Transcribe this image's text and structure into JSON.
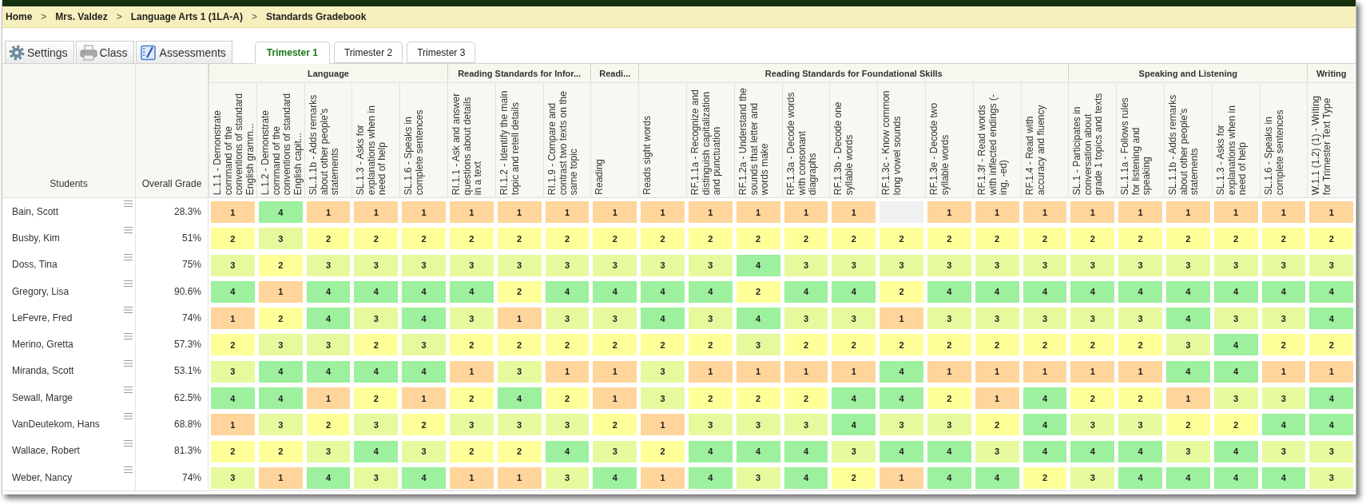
{
  "breadcrumb": [
    {
      "kind": "link",
      "text": "Home"
    },
    {
      "kind": "separator",
      "text": ">"
    },
    {
      "kind": "link",
      "text": "Mrs. Valdez"
    },
    {
      "kind": "separator",
      "text": ">"
    },
    {
      "kind": "link",
      "text": "Language Arts 1 (1LA-A)"
    },
    {
      "kind": "separator",
      "text": ">"
    },
    {
      "kind": "current",
      "text": "Standards Gradebook"
    }
  ],
  "toolbar": [
    {
      "label": "Settings"
    },
    {
      "label": "Class"
    },
    {
      "label": "Assessments"
    }
  ],
  "trimester_tabs": [
    {
      "label": "Trimester 1",
      "selected": true
    },
    {
      "label": "Trimester 2",
      "selected": false
    },
    {
      "label": "Trimester 3",
      "selected": false
    }
  ],
  "table": {
    "student_column": "Students",
    "grade_column": "Overall Grade",
    "groups": [
      {
        "title": "Language",
        "standards": [
          "L.1.1 - Demonstrate command of the conventions of standard English gramm...",
          "L.1.2 - Demonstrate command of the conventions of standard English capit...",
          "SL.1.1b - Adds remarks about other people's statements",
          "SL.1.3 - Asks for explanations when in need of help",
          "SL.1.6 - Speaks in complete sentences"
        ]
      },
      {
        "title": "Reading Standards for Infor...",
        "standards": [
          "RI.1.1 - Ask and answer questions about details in a text",
          "RI.1.2 - Identify the main topic and retell details",
          "RI.1.9 - Compare and contrast two texts on the same topic"
        ]
      },
      {
        "title": "Readi...",
        "standards": [
          "Reading"
        ]
      },
      {
        "title": "Reading Standards for Foundational Skills",
        "standards": [
          "Reads sight words",
          "RF.1.1a - Recognize and distinguish capitalization and punctuation",
          "RF.1.2a - Understand the sounds that letter and words make",
          "RF.1.3a - Decode words with consonant diagraphs",
          "RF.1.3b - Decode one syllable words",
          "RF.1.3c - Know common long vowel sounds",
          "RF.1.3e - Decode two syllable words",
          "RF.1.3f - Read words with inflected endings (-ing, -ed)",
          "RF.1.4 - Read with accuracy and fluency"
        ]
      },
      {
        "title": "Speaking and Listening",
        "standards": [
          "SL.1 - Participates in conversation about grade 1 topics and texts",
          "SL.1.1a - Follows rules for listening and speaking",
          "SL.1.1b - Adds remarks about other people's statements",
          "SL.1.3 - Asks for explanations when in need of help",
          "SL.1.6 - Speaks in complete sentences"
        ]
      },
      {
        "title": "Writing",
        "standards": [
          "W.1.1 (1.2) (1) - Writing for Trimester Text Type"
        ]
      }
    ],
    "rows": [
      {
        "student": "Bain, Scott",
        "grade": "28.3%",
        "scores": [
          {
            "score": "1",
            "color": "#ffd59b"
          },
          {
            "score": "4",
            "color": "#9df09d"
          },
          {
            "score": "1",
            "color": "#ffd59b"
          },
          {
            "score": "1",
            "color": "#ffd59b"
          },
          {
            "score": "1",
            "color": "#ffd59b"
          },
          {
            "score": "1",
            "color": "#ffd59b"
          },
          {
            "score": "1",
            "color": "#ffd59b"
          },
          {
            "score": "1",
            "color": "#ffd59b"
          },
          {
            "score": "1",
            "color": "#ffd59b"
          },
          {
            "score": "1",
            "color": "#ffd59b"
          },
          {
            "score": "1",
            "color": "#ffd59b"
          },
          {
            "score": "1",
            "color": "#ffd59b"
          },
          {
            "score": "1",
            "color": "#ffd59b"
          },
          {
            "score": "1",
            "color": "#ffd59b"
          },
          {
            "color": "#f0f0f0"
          },
          {
            "score": "1",
            "color": "#ffd59b"
          },
          {
            "score": "1",
            "color": "#ffd59b"
          },
          {
            "score": "1",
            "color": "#ffd59b"
          },
          {
            "score": "1",
            "color": "#ffd59b"
          },
          {
            "score": "1",
            "color": "#ffd59b"
          },
          {
            "score": "1",
            "color": "#ffd59b"
          },
          {
            "score": "1",
            "color": "#ffd59b"
          },
          {
            "score": "1",
            "color": "#ffd59b"
          },
          {
            "score": "1",
            "color": "#ffd59b"
          }
        ]
      },
      {
        "student": "Busby, Kim",
        "grade": "51%",
        "scores": [
          {
            "score": "2",
            "color": "#ffff99"
          },
          {
            "score": "3",
            "color": "#e6fa9d"
          },
          {
            "score": "2",
            "color": "#ffff99"
          },
          {
            "score": "2",
            "color": "#ffff99"
          },
          {
            "score": "2",
            "color": "#ffff99"
          },
          {
            "score": "2",
            "color": "#ffff99"
          },
          {
            "score": "2",
            "color": "#ffff99"
          },
          {
            "score": "2",
            "color": "#ffff99"
          },
          {
            "score": "2",
            "color": "#ffff99"
          },
          {
            "score": "2",
            "color": "#ffff99"
          },
          {
            "score": "2",
            "color": "#ffff99"
          },
          {
            "score": "2",
            "color": "#ffff99"
          },
          {
            "score": "2",
            "color": "#ffff99"
          },
          {
            "score": "2",
            "color": "#ffff99"
          },
          {
            "score": "2",
            "color": "#ffff99"
          },
          {
            "score": "2",
            "color": "#ffff99"
          },
          {
            "score": "2",
            "color": "#ffff99"
          },
          {
            "score": "2",
            "color": "#ffff99"
          },
          {
            "score": "2",
            "color": "#ffff99"
          },
          {
            "score": "2",
            "color": "#ffff99"
          },
          {
            "score": "2",
            "color": "#ffff99"
          },
          {
            "score": "2",
            "color": "#ffff99"
          },
          {
            "score": "2",
            "color": "#ffff99"
          },
          {
            "score": "2",
            "color": "#ffff99"
          }
        ]
      },
      {
        "student": "Doss, Tina",
        "grade": "75%",
        "scores": [
          {
            "score": "3",
            "color": "#e6fa9d"
          },
          {
            "score": "2",
            "color": "#ffff99"
          },
          {
            "score": "3",
            "color": "#e6fa9d"
          },
          {
            "score": "3",
            "color": "#e6fa9d"
          },
          {
            "score": "3",
            "color": "#e6fa9d"
          },
          {
            "score": "3",
            "color": "#e6fa9d"
          },
          {
            "score": "3",
            "color": "#e6fa9d"
          },
          {
            "score": "3",
            "color": "#e6fa9d"
          },
          {
            "score": "3",
            "color": "#e6fa9d"
          },
          {
            "score": "3",
            "color": "#e6fa9d"
          },
          {
            "score": "3",
            "color": "#e6fa9d"
          },
          {
            "score": "4",
            "color": "#9df09d"
          },
          {
            "score": "3",
            "color": "#e6fa9d"
          },
          {
            "score": "3",
            "color": "#e6fa9d"
          },
          {
            "score": "3",
            "color": "#e6fa9d"
          },
          {
            "score": "3",
            "color": "#e6fa9d"
          },
          {
            "score": "3",
            "color": "#e6fa9d"
          },
          {
            "score": "3",
            "color": "#e6fa9d"
          },
          {
            "score": "3",
            "color": "#e6fa9d"
          },
          {
            "score": "3",
            "color": "#e6fa9d"
          },
          {
            "score": "3",
            "color": "#e6fa9d"
          },
          {
            "score": "3",
            "color": "#e6fa9d"
          },
          {
            "score": "3",
            "color": "#e6fa9d"
          },
          {
            "score": "3",
            "color": "#e6fa9d"
          }
        ]
      },
      {
        "student": "Gregory, Lisa",
        "grade": "90.6%",
        "scores": [
          {
            "score": "4",
            "color": "#9df09d"
          },
          {
            "score": "1",
            "color": "#ffd59b"
          },
          {
            "score": "4",
            "color": "#9df09d"
          },
          {
            "score": "4",
            "color": "#9df09d"
          },
          {
            "score": "4",
            "color": "#9df09d"
          },
          {
            "score": "4",
            "color": "#9df09d"
          },
          {
            "score": "2",
            "color": "#ffff99"
          },
          {
            "score": "4",
            "color": "#9df09d"
          },
          {
            "score": "4",
            "color": "#9df09d"
          },
          {
            "score": "4",
            "color": "#9df09d"
          },
          {
            "score": "4",
            "color": "#9df09d"
          },
          {
            "score": "2",
            "color": "#ffff99"
          },
          {
            "score": "4",
            "color": "#9df09d"
          },
          {
            "score": "4",
            "color": "#9df09d"
          },
          {
            "score": "2",
            "color": "#ffff99"
          },
          {
            "score": "4",
            "color": "#9df09d"
          },
          {
            "score": "4",
            "color": "#9df09d"
          },
          {
            "score": "4",
            "color": "#9df09d"
          },
          {
            "score": "4",
            "color": "#9df09d"
          },
          {
            "score": "4",
            "color": "#9df09d"
          },
          {
            "score": "4",
            "color": "#9df09d"
          },
          {
            "score": "4",
            "color": "#9df09d"
          },
          {
            "score": "4",
            "color": "#9df09d"
          },
          {
            "score": "4",
            "color": "#9df09d"
          }
        ]
      },
      {
        "student": "LeFevre, Fred",
        "grade": "74%",
        "scores": [
          {
            "score": "1",
            "color": "#ffd59b"
          },
          {
            "score": "2",
            "color": "#ffff99"
          },
          {
            "score": "4",
            "color": "#9df09d"
          },
          {
            "score": "3",
            "color": "#e6fa9d"
          },
          {
            "score": "4",
            "color": "#9df09d"
          },
          {
            "score": "3",
            "color": "#e6fa9d"
          },
          {
            "score": "1",
            "color": "#ffd59b"
          },
          {
            "score": "3",
            "color": "#e6fa9d"
          },
          {
            "score": "3",
            "color": "#e6fa9d"
          },
          {
            "score": "4",
            "color": "#9df09d"
          },
          {
            "score": "3",
            "color": "#e6fa9d"
          },
          {
            "score": "4",
            "color": "#9df09d"
          },
          {
            "score": "3",
            "color": "#e6fa9d"
          },
          {
            "score": "3",
            "color": "#e6fa9d"
          },
          {
            "score": "1",
            "color": "#ffd59b"
          },
          {
            "score": "3",
            "color": "#e6fa9d"
          },
          {
            "score": "3",
            "color": "#e6fa9d"
          },
          {
            "score": "3",
            "color": "#e6fa9d"
          },
          {
            "score": "3",
            "color": "#e6fa9d"
          },
          {
            "score": "3",
            "color": "#e6fa9d"
          },
          {
            "score": "4",
            "color": "#9df09d"
          },
          {
            "score": "3",
            "color": "#e6fa9d"
          },
          {
            "score": "3",
            "color": "#e6fa9d"
          },
          {
            "score": "4",
            "color": "#9df09d"
          }
        ]
      },
      {
        "student": "Merino, Gretta",
        "grade": "57.3%",
        "scores": [
          {
            "score": "2",
            "color": "#ffff99"
          },
          {
            "score": "3",
            "color": "#e6fa9d"
          },
          {
            "score": "3",
            "color": "#e6fa9d"
          },
          {
            "score": "2",
            "color": "#ffff99"
          },
          {
            "score": "3",
            "color": "#e6fa9d"
          },
          {
            "score": "2",
            "color": "#ffff99"
          },
          {
            "score": "2",
            "color": "#ffff99"
          },
          {
            "score": "2",
            "color": "#ffff99"
          },
          {
            "score": "2",
            "color": "#ffff99"
          },
          {
            "score": "2",
            "color": "#ffff99"
          },
          {
            "score": "2",
            "color": "#ffff99"
          },
          {
            "score": "3",
            "color": "#e6fa9d"
          },
          {
            "score": "2",
            "color": "#ffff99"
          },
          {
            "score": "2",
            "color": "#ffff99"
          },
          {
            "score": "2",
            "color": "#ffff99"
          },
          {
            "score": "2",
            "color": "#ffff99"
          },
          {
            "score": "2",
            "color": "#ffff99"
          },
          {
            "score": "2",
            "color": "#ffff99"
          },
          {
            "score": "2",
            "color": "#ffff99"
          },
          {
            "score": "2",
            "color": "#ffff99"
          },
          {
            "score": "3",
            "color": "#e6fa9d"
          },
          {
            "score": "4",
            "color": "#9df09d"
          },
          {
            "score": "2",
            "color": "#ffff99"
          },
          {
            "score": "2",
            "color": "#ffff99"
          }
        ]
      },
      {
        "student": "Miranda, Scott",
        "grade": "53.1%",
        "scores": [
          {
            "score": "3",
            "color": "#e6fa9d"
          },
          {
            "score": "4",
            "color": "#9df09d"
          },
          {
            "score": "4",
            "color": "#9df09d"
          },
          {
            "score": "4",
            "color": "#9df09d"
          },
          {
            "score": "4",
            "color": "#9df09d"
          },
          {
            "score": "1",
            "color": "#ffd59b"
          },
          {
            "score": "3",
            "color": "#e6fa9d"
          },
          {
            "score": "1",
            "color": "#ffd59b"
          },
          {
            "score": "1",
            "color": "#ffd59b"
          },
          {
            "score": "3",
            "color": "#e6fa9d"
          },
          {
            "score": "1",
            "color": "#ffd59b"
          },
          {
            "score": "1",
            "color": "#ffd59b"
          },
          {
            "score": "1",
            "color": "#ffd59b"
          },
          {
            "score": "1",
            "color": "#ffd59b"
          },
          {
            "score": "4",
            "color": "#9df09d"
          },
          {
            "score": "1",
            "color": "#ffd59b"
          },
          {
            "score": "1",
            "color": "#ffd59b"
          },
          {
            "score": "1",
            "color": "#ffd59b"
          },
          {
            "score": "1",
            "color": "#ffd59b"
          },
          {
            "score": "1",
            "color": "#ffd59b"
          },
          {
            "score": "4",
            "color": "#9df09d"
          },
          {
            "score": "4",
            "color": "#9df09d"
          },
          {
            "score": "1",
            "color": "#ffd59b"
          },
          {
            "score": "1",
            "color": "#ffd59b"
          }
        ]
      },
      {
        "student": "Sewall, Marge",
        "grade": "62.5%",
        "scores": [
          {
            "score": "4",
            "color": "#9df09d"
          },
          {
            "score": "4",
            "color": "#9df09d"
          },
          {
            "score": "1",
            "color": "#ffd59b"
          },
          {
            "score": "2",
            "color": "#ffff99"
          },
          {
            "score": "1",
            "color": "#ffd59b"
          },
          {
            "score": "2",
            "color": "#ffff99"
          },
          {
            "score": "4",
            "color": "#9df09d"
          },
          {
            "score": "2",
            "color": "#ffff99"
          },
          {
            "score": "1",
            "color": "#ffd59b"
          },
          {
            "score": "3",
            "color": "#e6fa9d"
          },
          {
            "score": "2",
            "color": "#ffff99"
          },
          {
            "score": "2",
            "color": "#ffff99"
          },
          {
            "score": "2",
            "color": "#ffff99"
          },
          {
            "score": "4",
            "color": "#9df09d"
          },
          {
            "score": "4",
            "color": "#9df09d"
          },
          {
            "score": "2",
            "color": "#ffff99"
          },
          {
            "score": "1",
            "color": "#ffd59b"
          },
          {
            "score": "4",
            "color": "#9df09d"
          },
          {
            "score": "2",
            "color": "#ffff99"
          },
          {
            "score": "2",
            "color": "#ffff99"
          },
          {
            "score": "1",
            "color": "#ffd59b"
          },
          {
            "score": "3",
            "color": "#e6fa9d"
          },
          {
            "score": "3",
            "color": "#e6fa9d"
          },
          {
            "score": "4",
            "color": "#9df09d"
          }
        ]
      },
      {
        "student": "VanDeutekom, Hans",
        "grade": "68.8%",
        "scores": [
          {
            "score": "1",
            "color": "#ffd59b"
          },
          {
            "score": "3",
            "color": "#e6fa9d"
          },
          {
            "score": "2",
            "color": "#ffff99"
          },
          {
            "score": "3",
            "color": "#e6fa9d"
          },
          {
            "score": "2",
            "color": "#ffff99"
          },
          {
            "score": "3",
            "color": "#e6fa9d"
          },
          {
            "score": "3",
            "color": "#e6fa9d"
          },
          {
            "score": "3",
            "color": "#e6fa9d"
          },
          {
            "score": "2",
            "color": "#ffff99"
          },
          {
            "score": "1",
            "color": "#ffd59b"
          },
          {
            "score": "3",
            "color": "#e6fa9d"
          },
          {
            "score": "3",
            "color": "#e6fa9d"
          },
          {
            "score": "3",
            "color": "#e6fa9d"
          },
          {
            "score": "4",
            "color": "#9df09d"
          },
          {
            "score": "3",
            "color": "#e6fa9d"
          },
          {
            "score": "3",
            "color": "#e6fa9d"
          },
          {
            "score": "2",
            "color": "#ffff99"
          },
          {
            "score": "4",
            "color": "#9df09d"
          },
          {
            "score": "3",
            "color": "#e6fa9d"
          },
          {
            "score": "3",
            "color": "#e6fa9d"
          },
          {
            "score": "2",
            "color": "#ffff99"
          },
          {
            "score": "2",
            "color": "#ffff99"
          },
          {
            "score": "4",
            "color": "#9df09d"
          },
          {
            "score": "4",
            "color": "#9df09d"
          }
        ]
      },
      {
        "student": "Wallace, Robert",
        "grade": "81.3%",
        "scores": [
          {
            "score": "2",
            "color": "#ffff99"
          },
          {
            "score": "2",
            "color": "#ffff99"
          },
          {
            "score": "3",
            "color": "#e6fa9d"
          },
          {
            "score": "4",
            "color": "#9df09d"
          },
          {
            "score": "3",
            "color": "#e6fa9d"
          },
          {
            "score": "2",
            "color": "#ffff99"
          },
          {
            "score": "2",
            "color": "#ffff99"
          },
          {
            "score": "4",
            "color": "#9df09d"
          },
          {
            "score": "3",
            "color": "#e6fa9d"
          },
          {
            "score": "2",
            "color": "#ffff99"
          },
          {
            "score": "4",
            "color": "#9df09d"
          },
          {
            "score": "4",
            "color": "#9df09d"
          },
          {
            "score": "4",
            "color": "#9df09d"
          },
          {
            "score": "3",
            "color": "#e6fa9d"
          },
          {
            "score": "4",
            "color": "#9df09d"
          },
          {
            "score": "4",
            "color": "#9df09d"
          },
          {
            "score": "3",
            "color": "#e6fa9d"
          },
          {
            "score": "4",
            "color": "#9df09d"
          },
          {
            "score": "4",
            "color": "#9df09d"
          },
          {
            "score": "4",
            "color": "#9df09d"
          },
          {
            "score": "3",
            "color": "#e6fa9d"
          },
          {
            "score": "4",
            "color": "#9df09d"
          },
          {
            "score": "3",
            "color": "#e6fa9d"
          },
          {
            "score": "3",
            "color": "#e6fa9d"
          }
        ]
      },
      {
        "student": "Weber, Nancy",
        "grade": "74%",
        "scores": [
          {
            "score": "3",
            "color": "#e6fa9d"
          },
          {
            "score": "1",
            "color": "#ffd59b"
          },
          {
            "score": "4",
            "color": "#9df09d"
          },
          {
            "score": "3",
            "color": "#e6fa9d"
          },
          {
            "score": "4",
            "color": "#9df09d"
          },
          {
            "score": "1",
            "color": "#ffd59b"
          },
          {
            "score": "1",
            "color": "#ffd59b"
          },
          {
            "score": "3",
            "color": "#e6fa9d"
          },
          {
            "score": "4",
            "color": "#9df09d"
          },
          {
            "score": "1",
            "color": "#ffd59b"
          },
          {
            "score": "4",
            "color": "#9df09d"
          },
          {
            "score": "3",
            "color": "#e6fa9d"
          },
          {
            "score": "4",
            "color": "#9df09d"
          },
          {
            "score": "2",
            "color": "#ffff99"
          },
          {
            "score": "1",
            "color": "#ffd59b"
          },
          {
            "score": "4",
            "color": "#9df09d"
          },
          {
            "score": "4",
            "color": "#9df09d"
          },
          {
            "score": "2",
            "color": "#ffff99"
          },
          {
            "score": "3",
            "color": "#e6fa9d"
          },
          {
            "score": "4",
            "color": "#9df09d"
          },
          {
            "score": "4",
            "color": "#9df09d"
          },
          {
            "score": "4",
            "color": "#9df09d"
          },
          {
            "score": "4",
            "color": "#9df09d"
          },
          {
            "score": "3",
            "color": "#e6fa9d"
          }
        ]
      }
    ]
  }
}
